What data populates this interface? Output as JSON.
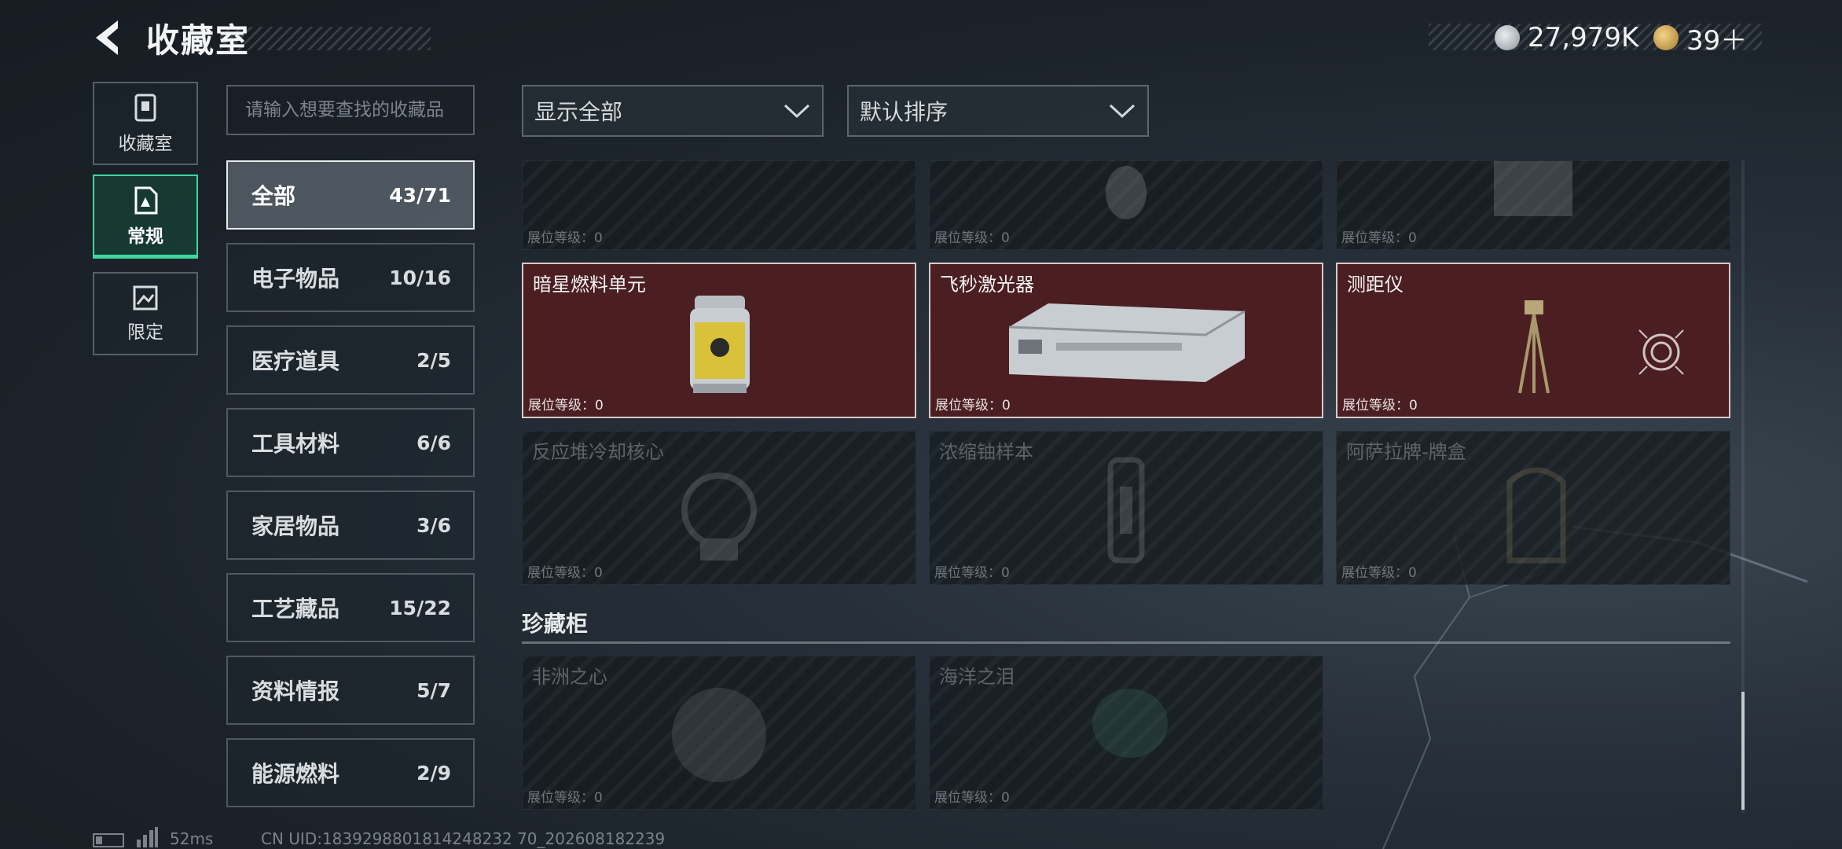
{
  "header": {
    "title": "收藏室",
    "currency_silver": "27,979K",
    "currency_gold": "39＋"
  },
  "rail": [
    {
      "label": "收藏室",
      "icon": "safe-icon"
    },
    {
      "label": "常规",
      "icon": "document-icon"
    },
    {
      "label": "限定",
      "icon": "picture-icon"
    }
  ],
  "search": {
    "placeholder": "请输入想要查找的收藏品"
  },
  "categories": [
    {
      "name": "全部",
      "count": "43/71"
    },
    {
      "name": "电子物品",
      "count": "10/16"
    },
    {
      "name": "医疗道具",
      "count": "2/5"
    },
    {
      "name": "工具材料",
      "count": "6/6"
    },
    {
      "name": "家居物品",
      "count": "3/6"
    },
    {
      "name": "工艺藏品",
      "count": "15/22"
    },
    {
      "name": "资料情报",
      "count": "5/7"
    },
    {
      "name": "能源燃料",
      "count": "2/9"
    }
  ],
  "filters": {
    "show": "显示全部",
    "sort": "默认排序"
  },
  "level_label": "展位等级：0",
  "grid": {
    "row_top": [
      {
        "name": ""
      },
      {
        "name": ""
      },
      {
        "name": ""
      }
    ],
    "row_owned": [
      {
        "name": "暗星燃料单元"
      },
      {
        "name": "飞秒激光器"
      },
      {
        "name": "测距仪"
      }
    ],
    "row_locked": [
      {
        "name": "反应堆冷却核心"
      },
      {
        "name": "浓缩铀样本"
      },
      {
        "name": "阿萨拉牌-牌盒"
      }
    ]
  },
  "treasure": {
    "title": "珍藏柜",
    "items": [
      {
        "name": "非洲之心"
      },
      {
        "name": "海洋之泪"
      }
    ]
  },
  "footer": {
    "ping": "52ms",
    "uid": "CN UID:1839298801814248232 70_202608182239"
  },
  "colors": {
    "accent": "#3fd6a0",
    "owned_card": "#4b1e21"
  }
}
